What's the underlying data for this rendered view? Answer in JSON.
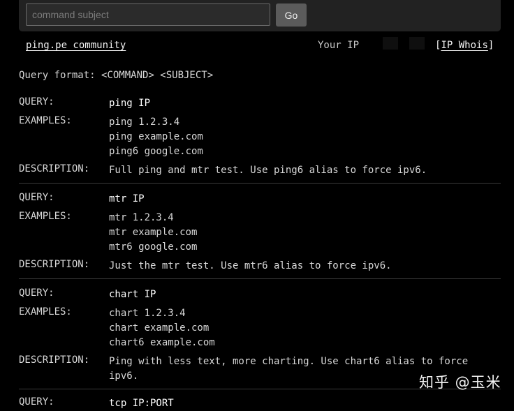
{
  "search": {
    "placeholder": "command subject",
    "go_label": "Go"
  },
  "header": {
    "community_label": "ping.pe community",
    "ip_label": "Your IP",
    "whois_open": "[",
    "whois_label": "IP Whois",
    "whois_close": "]"
  },
  "query_format": "Query format: <COMMAND> <SUBJECT>",
  "labels": {
    "query": "QUERY:",
    "examples": "EXAMPLES:",
    "description": "DESCRIPTION:"
  },
  "commands": [
    {
      "query": "ping IP",
      "examples": [
        "ping 1.2.3.4",
        "ping example.com",
        "ping6 google.com"
      ],
      "description": [
        "Full ping and mtr test. Use ping6 alias to force ipv6."
      ]
    },
    {
      "query": "mtr IP",
      "examples": [
        "mtr 1.2.3.4",
        "mtr example.com",
        "mtr6 google.com"
      ],
      "description": [
        "Just the mtr test. Use mtr6 alias to force ipv6."
      ]
    },
    {
      "query": "chart IP",
      "examples": [
        "chart 1.2.3.4",
        "chart example.com",
        "chart6 example.com"
      ],
      "description": [
        "Ping with less text, more charting. Use chart6 alias to force",
        "ipv6."
      ]
    },
    {
      "query": "tcp IP:PORT",
      "examples": [],
      "description": []
    }
  ],
  "watermark": "知乎 @玉米"
}
